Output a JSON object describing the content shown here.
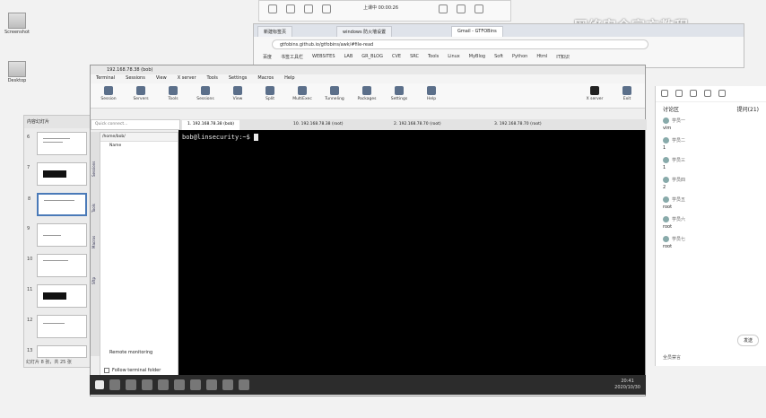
{
  "desktop": {
    "icons": [
      {
        "label": "Screenshot"
      },
      {
        "label": "Desktop"
      }
    ],
    "watermark": "网络安全官方教程"
  },
  "slides": {
    "header": "内容幻灯片",
    "thumbnails": [
      "6",
      "7",
      "8",
      "9",
      "10",
      "11",
      "12",
      "13"
    ],
    "footer": "幻灯片 8 张，共 25 张"
  },
  "browser": {
    "top_time": "上课中 00:00:26",
    "tabs": [
      "新建标签页",
      "windows 防火墙设置",
      "Gmail - GTFOBins"
    ],
    "address": "gtfobins.github.io/gtfobins/awk/#file-read",
    "bookmarks": [
      "百度",
      "书签工具栏",
      "WEBSITES",
      "LAB",
      "GR_BLOG",
      "CVE",
      "SRC",
      "Tools",
      "Linux",
      "MyBlog",
      "Soft",
      "Python",
      "Html",
      "IT知识"
    ]
  },
  "moba": {
    "title": "192.168.78.38 (bob)",
    "menu": [
      "Terminal",
      "Sessions",
      "View",
      "X server",
      "Tools",
      "Settings",
      "Macros",
      "Help"
    ],
    "tools": [
      "Session",
      "Servers",
      "Tools",
      "Sessions",
      "View",
      "Split",
      "MultiExec",
      "Tunneling",
      "Packages",
      "Settings",
      "Help"
    ],
    "right_tools": [
      "X server",
      "Exit"
    ],
    "quick": "Quick connect...",
    "session_tabs": [
      "1. 192.168.78.38 (bob)",
      "10. 192.168.78.38 (root)",
      "2. 192.168.78.70 (root)",
      "3. 192.168.78.70 (root)"
    ],
    "sidebar_labels": [
      "Sessions",
      "Tools",
      "Macros",
      "Sftp"
    ],
    "sftp": {
      "path": "/home/bob/",
      "column": "Name",
      "remote": "Remote monitoring",
      "follow": "Follow terminal folder"
    },
    "prompt": "bob@linsecurity:~$"
  },
  "taskbar": {
    "time": "20:41",
    "date": "2020/10/30"
  },
  "chat": {
    "tab_left": "讨论区",
    "tab_right": "提问(21)",
    "messages": [
      {
        "user": "学员一",
        "text": "vim"
      },
      {
        "user": "学员二",
        "text": "1"
      },
      {
        "user": "学员三",
        "text": "1"
      },
      {
        "user": "学员四",
        "text": "2"
      },
      {
        "user": "学员五",
        "text": "root"
      },
      {
        "user": "学员六",
        "text": "root"
      },
      {
        "user": "学员七",
        "text": "root"
      }
    ],
    "send": "发送",
    "bottom": "全员禁言"
  }
}
